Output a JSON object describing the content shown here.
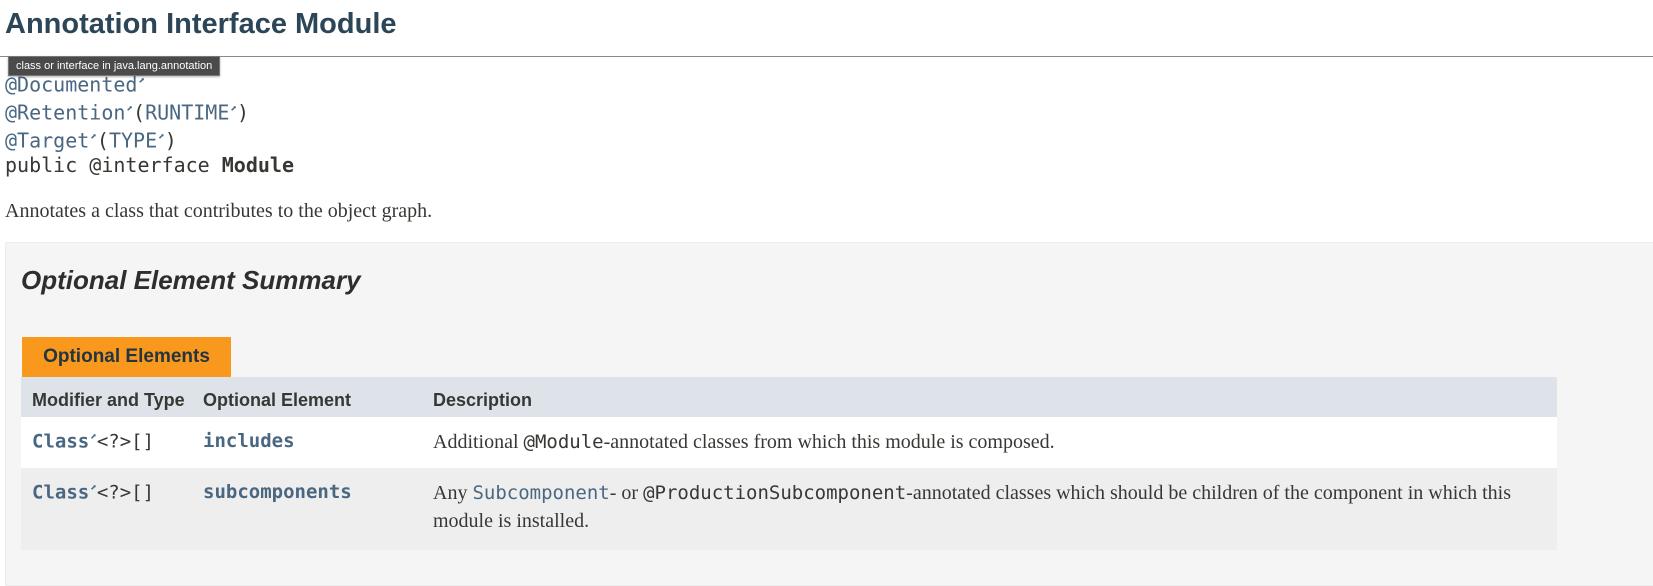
{
  "page": {
    "title": "Annotation Interface Module",
    "tooltip": "class or interface in java.lang.annotation",
    "description": "Annotates a class that contributes to the object graph."
  },
  "signature": {
    "documented": "@Documented",
    "retention": "@Retention",
    "retention_value": "RUNTIME",
    "target": "@Target",
    "target_value": "TYPE",
    "declaration_prefix": "public @interface ",
    "declaration_name": "Module",
    "open_paren": "(",
    "close_paren": ")"
  },
  "summary": {
    "heading": "Optional Element Summary",
    "tab_label": "Optional Elements",
    "columns": [
      "Modifier and Type",
      "Optional Element",
      "Description"
    ],
    "rows": [
      {
        "type_link": "Class",
        "type_suffix": "<?>[]",
        "element": "includes",
        "desc_prefix": "Additional ",
        "desc_code": "@Module",
        "desc_suffix": "-annotated classes from which this module is composed."
      },
      {
        "type_link": "Class",
        "type_suffix": "<?>[]",
        "element": "subcomponents",
        "desc_prefix": "Any ",
        "desc_link": "Subcomponent",
        "desc_middle": "- or ",
        "desc_code": "@ProductionSubcomponent",
        "desc_suffix": "-annotated classes which should be children of the component in which this module is installed."
      }
    ]
  },
  "icons": {
    "external_link": "external-link-icon"
  },
  "colors": {
    "title": "#2c4557",
    "link": "#4a6782",
    "tab": "#f8981d",
    "table_header": "#dee3e9"
  }
}
